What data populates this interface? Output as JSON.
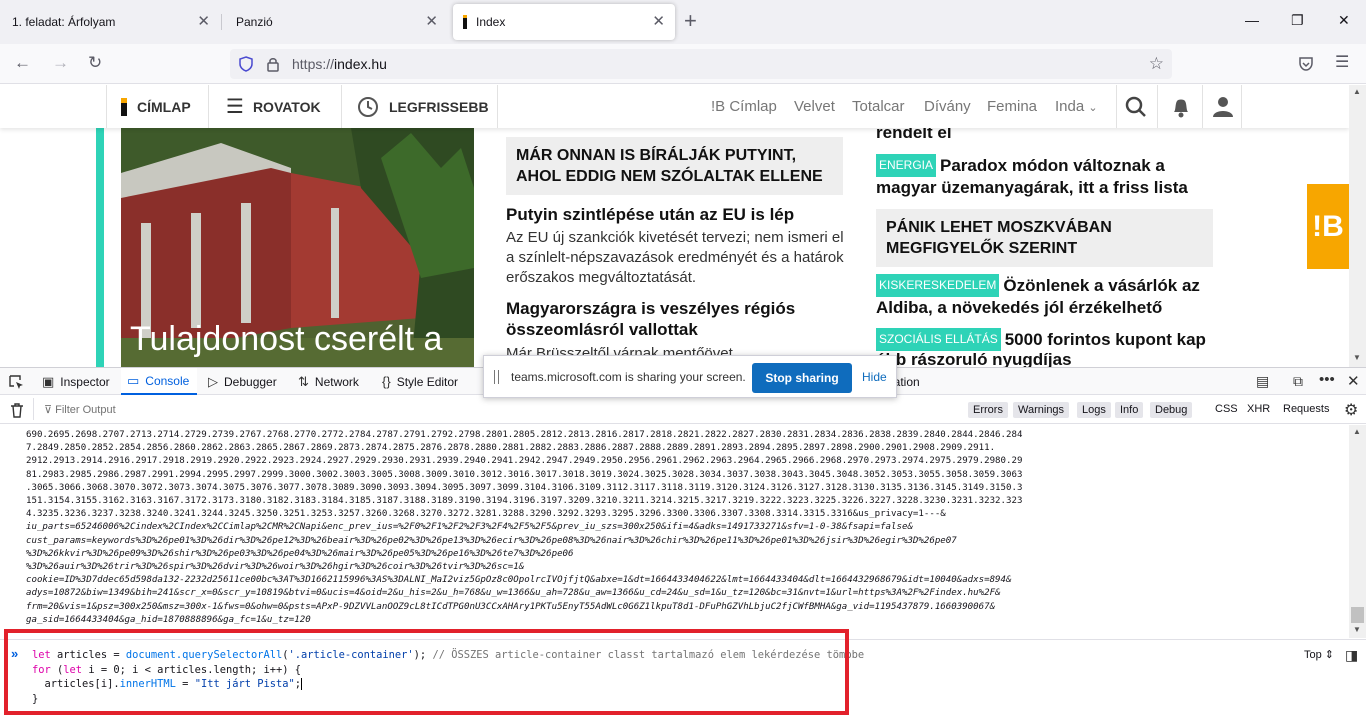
{
  "browser": {
    "tabs": [
      {
        "title": "1. feladat: Árfolyam"
      },
      {
        "title": "Panzió"
      },
      {
        "title": "Index"
      }
    ],
    "url_scheme": "https://",
    "url_host": "index.hu"
  },
  "site": {
    "nav": {
      "cimlap": "CÍMLAP",
      "rovatok": "ROVATOK",
      "legfrissebb": "LEGFRISSEBB"
    },
    "links": [
      "!B Címlap",
      "Velvet",
      "Totalcar",
      "Dívány",
      "Femina",
      "Inda"
    ],
    "photo_title": "Tulajdonost cserélt a",
    "middle": {
      "box_title": "MÁR ONNAN IS BÍRÁLJÁK PUTYINT, AHOL EDDIG NEM SZÓLALTAK ELLENE",
      "art1_title": "Putyin szintlépése után az EU is lép",
      "art1_lead": "Az EU új szankciók kivetését tervezi; nem ismeri el a színlelt-népszavazások eredményét és a határok erőszakos megváltoztatását.",
      "art2_title": "Magyarországra is veszélyes régiós összeomlásról vallottak",
      "art2_lead": "Már Brüsszeltől várnak mentőövet"
    },
    "right": {
      "top_cut": "rendelt el",
      "a1_label": "ENERGIA",
      "a1_title": "Paradox módon változnak a magyar üzemanyagárak, itt a friss lista",
      "box_title": "PÁNIK LEHET MOSZKVÁBAN MEGFIGYELŐK SZERINT",
      "a2_label": "KISKERESKEDELEM",
      "a2_title": "Özönlenek a vásárlók az Aldiba, a növekedés jól érzékelhető",
      "a3_label": "SZOCIÁLIS ELLÁTÁS",
      "a3_title": "5000 forintos kupont kap",
      "a3_cut": "ább rászoruló nyugdíjas"
    },
    "badge": "!B"
  },
  "devtools": {
    "tabs": [
      "Inspector",
      "Console",
      "Debugger",
      "Network",
      "Style Editor",
      "ication"
    ],
    "filter_placeholder": "Filter Output",
    "levels": [
      "Errors",
      "Warnings",
      "Logs",
      "Info",
      "Debug"
    ],
    "extra": [
      "CSS",
      "XHR",
      "Requests"
    ],
    "output_lines": [
      "690.2695.2698.2707.2713.2714.2729.2739.2767.2768.2770.2772.2784.2787.2791.2792.2798.2801.2805.2812.2813.2816.2817.2818.2821.2822.2827.2830.2831.2834.2836.2838.2839.2840.2844.2846.284",
      "7.2849.2850.2852.2854.2856.2860.2862.2863.2865.2867.2869.2873.2874.2875.2876.2878.2880.2881.2882.2883.2886.2887.2888.2889.2891.2893.2894.2895.2897.2898.2900.2901.2908.2909.2911.",
      "2912.2913.2914.2916.2917.2918.2919.2920.2922.2923.2924.2927.2929.2930.2931.2939.2940.2941.2942.2947.2949.2950.2956.2961.2962.2963.2964.2965.2966.2968.2970.2973.2974.2975.2979.2980.29",
      "81.2983.2985.2986.2987.2991.2994.2995.2997.2999.3000.3002.3003.3005.3008.3009.3010.3012.3016.3017.3018.3019.3024.3025.3028.3034.3037.3038.3043.3045.3048.3052.3053.3055.3058.3059.3063",
      ".3065.3066.3068.3070.3072.3073.3074.3075.3076.3077.3078.3089.3090.3093.3094.3095.3097.3099.3104.3106.3109.3112.3117.3118.3119.3120.3124.3126.3127.3128.3130.3135.3136.3145.3149.3150.3",
      "151.3154.3155.3162.3163.3167.3172.3173.3180.3182.3183.3184.3185.3187.3188.3189.3190.3194.3196.3197.3209.3210.3211.3214.3215.3217.3219.3222.3223.3225.3226.3227.3228.3230.3231.3232.323",
      "4.3235.3236.3237.3238.3240.3241.3244.3245.3250.3251.3253.3257.3260.3268.3270.3272.3281.3288.3290.3292.3293.3295.3296.3300.3306.3307.3308.3314.3315.3316&us_privacy=1---&",
      "iu_parts=65246006%2Cindex%2CIndex%2CCimlap%2CMR%2CNapi&enc_prev_ius=%2F0%2F1%2F2%2F3%2F4%2F5%2F5&prev_iu_szs=300x250&ifi=4&adks=1491733271&sfv=1-0-38&fsapi=false&",
      "cust_params=keywords%3D%26pe01%3D%26dir%3D%26pe12%3D%26beair%3D%26pe02%3D%26pe13%3D%26ecir%3D%26pe08%3D%26nair%3D%26chir%3D%26pe11%3D%26pe01%3D%26jsir%3D%26egir%3D%26pe07",
      "%3D%26kkvir%3D%26pe09%3D%26shir%3D%26pe03%3D%26pe04%3D%26mair%3D%26pe05%3D%26pe16%3D%26te7%3D%26pe06",
      "%3D%26auir%3D%26trir%3D%26spir%3D%26dvir%3D%26woir%3D%26hgir%3D%26coir%3D%26tvir%3D%26sc=1&",
      "cookie=ID%3D7ddec65d598da132-2232d25611ce00bc%3AT%3D1662115996%3AS%3DALNI_MaI2viz5GpOz8c0OpolrcIVOjfjtQ&abxe=1&dt=1664433404622&lmt=1664433404&dlt=1664432968679&idt=10040&adxs=894&",
      "adys=10872&biw=1349&bih=241&scr_x=0&scr_y=10819&btvi=0&ucis=4&oid=2&u_his=2&u_h=768&u_w=1366&u_ah=728&u_aw=1366&u_cd=24&u_sd=1&u_tz=120&bc=31&nvt=1&url=https%3A%2F%2Findex.hu%2F&",
      "frm=20&vis=1&psz=300x250&msz=300x-1&fws=0&ohw=0&psts=APxP-9DZVVLanOOZ9cL8tICdTPG0nU3CCxAHAry1PKTu5EnyT55AdWLc0G6Z1lkpuT8d1-DFuPhGZVhLbjuC2fjCWfBMHA&ga_vid=1195437879.1660390067&",
      "ga_sid=1664433404&ga_hid=1870888896&ga_fc=1&u_tz=120"
    ],
    "input_lines": [
      {
        "kw": "let",
        "rest1": " articles = ",
        "fn": "document.querySelectorAll",
        "rest2": "(",
        "str": "'.article-container'",
        "rest3": "); ",
        "cm": "// ÖSSZES article-container classt tartalmazó elem lekérdezése tömbbe"
      },
      {
        "kw": "for",
        "rest1": " (",
        "kw2": "let",
        "rest2": " i = 0; i < articles.length; i++) {"
      },
      {
        "rest1": "  articles[i].",
        "fn": "innerHTML",
        "rest2": " = ",
        "str": "\"Itt járt Pista\"",
        "rest3": ";"
      },
      {
        "rest1": "}"
      }
    ],
    "top_select": "Top"
  },
  "share": {
    "message": "teams.microsoft.com is sharing your screen.",
    "stop": "Stop sharing",
    "hide": "Hide"
  },
  "colors": {
    "accent": "#2ed3b7",
    "brand": "#f7a600",
    "devtools_active": "#0060df",
    "highlight": "#e2212b",
    "teams": "#0f6cbd"
  }
}
